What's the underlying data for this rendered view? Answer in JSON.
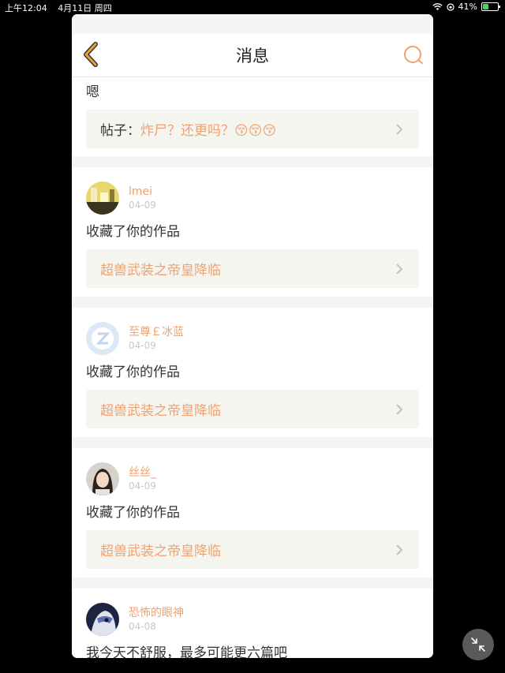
{
  "status_bar": {
    "time": "上午12:04",
    "date": "4月11日 周四",
    "battery": "41%",
    "battery_level": 0.41
  },
  "navbar": {
    "title": "消息",
    "accent_color": "#e8a035"
  },
  "top_card": {
    "message": "嗯",
    "reference": {
      "prefix": "帖子：",
      "text": "炸尸？还更吗？😚😚😚"
    }
  },
  "notifications": [
    {
      "username": "lmei",
      "date": "04-09",
      "message": "收藏了你的作品",
      "reference": "超兽武装之帝皇降临"
    },
    {
      "username": "至尊￡冰蓝",
      "date": "04-09",
      "message": "收藏了你的作品",
      "reference": "超兽武装之帝皇降临"
    },
    {
      "username": "丝丝_",
      "date": "04-09",
      "message": "收藏了你的作品",
      "reference": "超兽武装之帝皇降临"
    },
    {
      "username": "恐怖的眼神",
      "date": "04-08",
      "message": "我今天不舒服，最多可能更六篇吧"
    }
  ],
  "colors": {
    "username": "#f0a170",
    "reference_bg": "#f5f5ef",
    "separator": "#f5f5f5"
  }
}
